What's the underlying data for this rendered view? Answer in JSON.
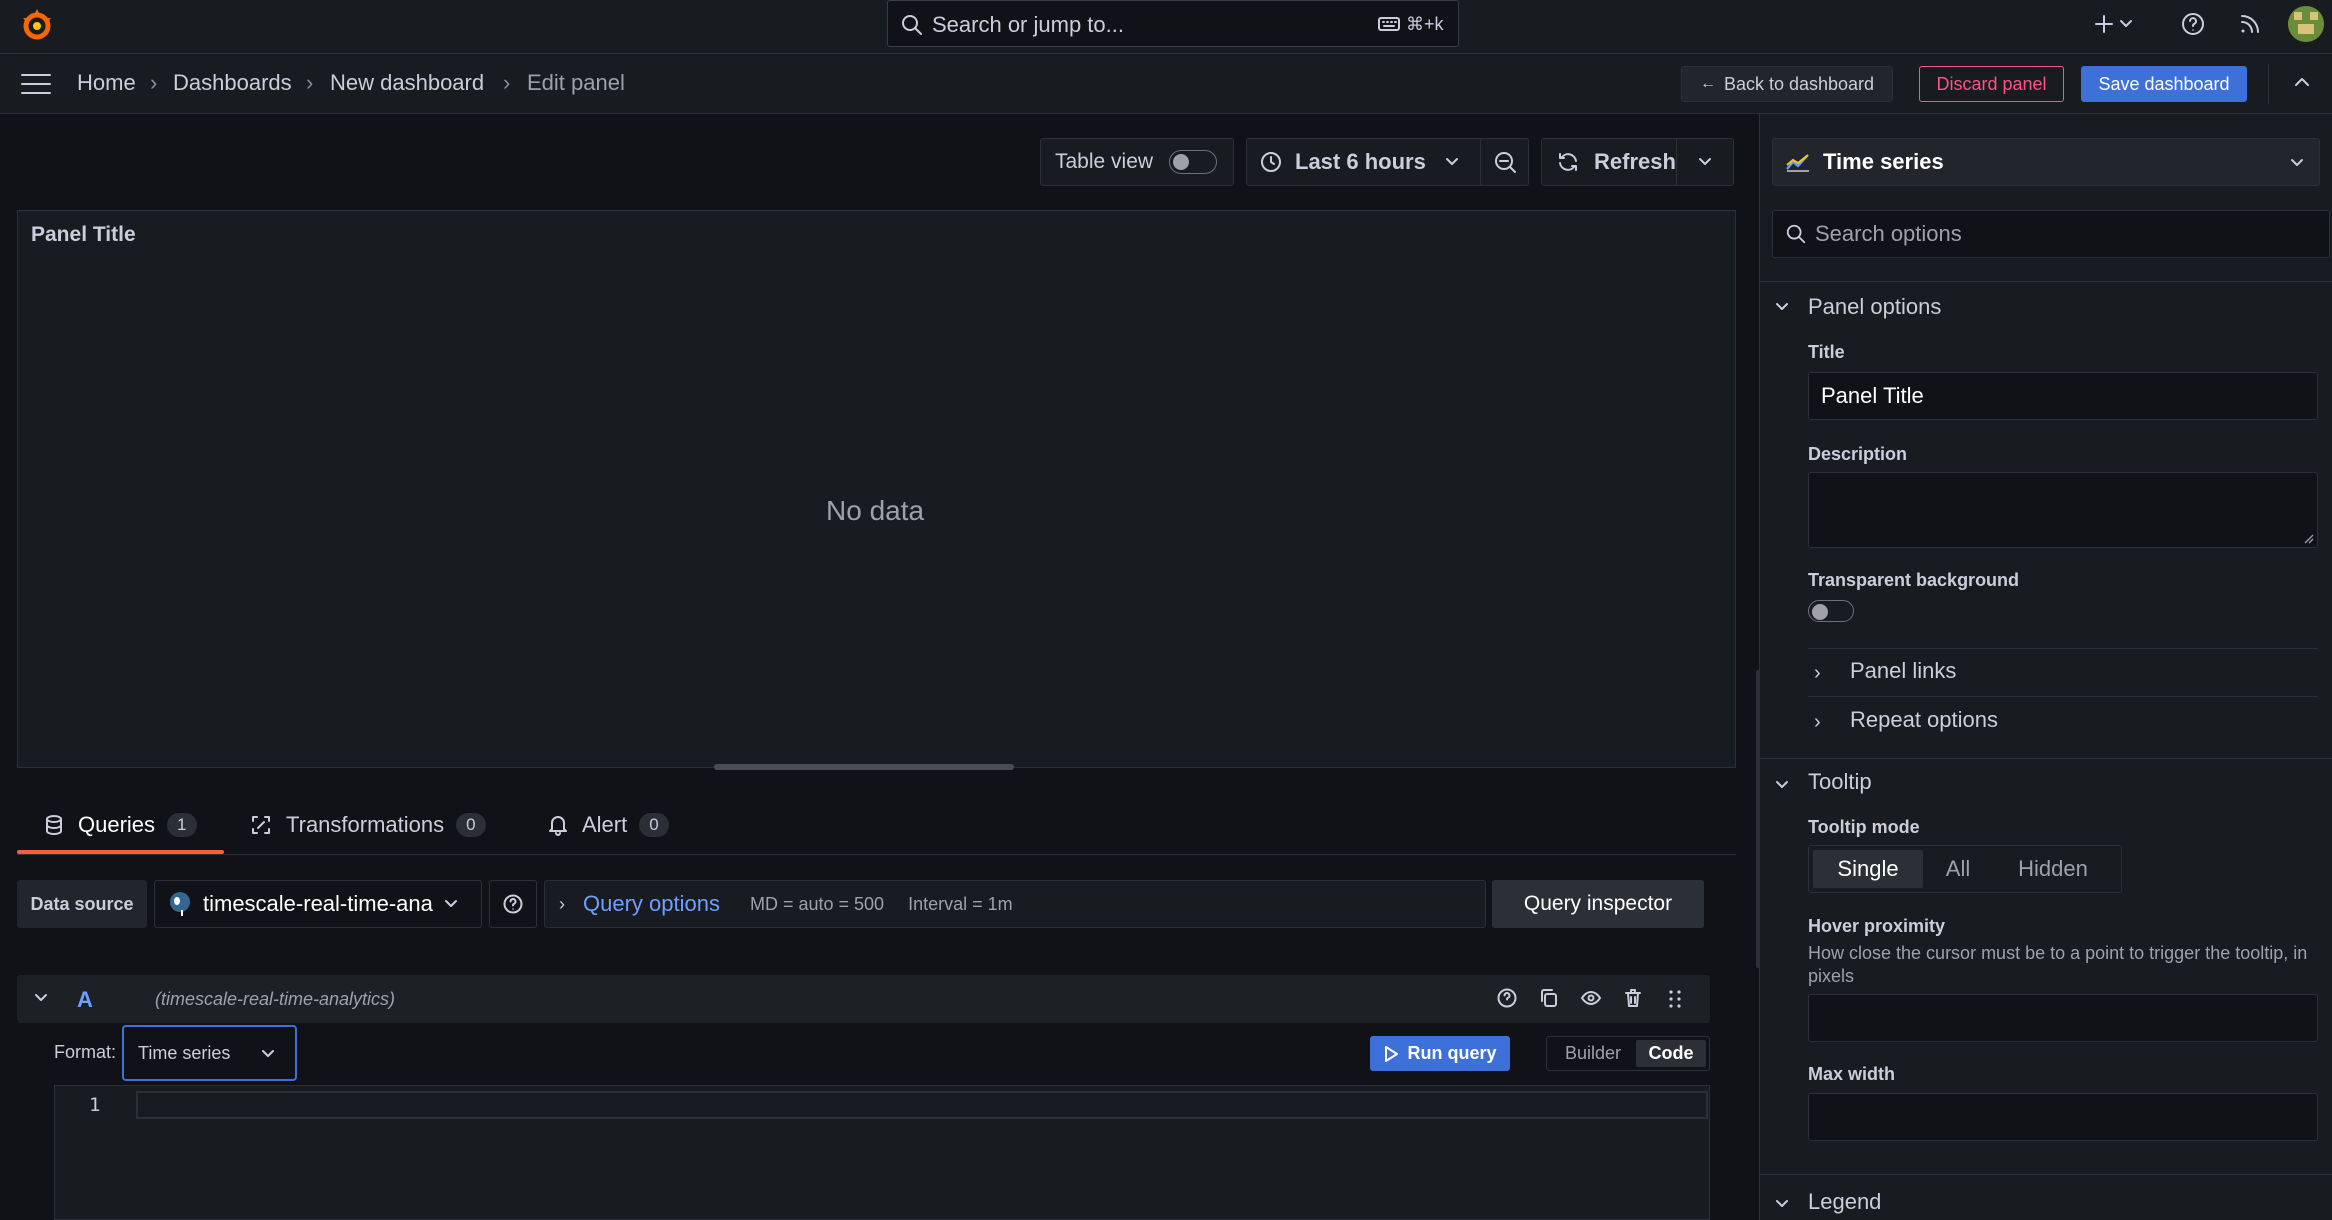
{
  "topbar": {
    "search_placeholder": "Search or jump to...",
    "search_shortcut": "⌘+k"
  },
  "breadcrumbs": [
    "Home",
    "Dashboards",
    "New dashboard",
    "Edit panel"
  ],
  "actions": {
    "back": "Back to dashboard",
    "discard": "Discard panel",
    "save": "Save dashboard"
  },
  "toolbar": {
    "table_view": "Table view",
    "time_range": "Last 6 hours",
    "refresh": "Refresh"
  },
  "panel": {
    "title": "Panel Title",
    "empty": "No data"
  },
  "tabs": [
    {
      "label": "Queries",
      "count": "1"
    },
    {
      "label": "Transformations",
      "count": "0"
    },
    {
      "label": "Alert",
      "count": "0"
    }
  ],
  "query_row": {
    "datasource_label": "Data source",
    "datasource_value": "timescale-real-time-ana",
    "query_options": "Query options",
    "md": "MD = auto = 500",
    "interval": "Interval = 1m",
    "inspector": "Query inspector"
  },
  "query": {
    "ref": "A",
    "datasource_hint": "(timescale-real-time-analytics)",
    "format_label": "Format:",
    "format_value": "Time series",
    "run": "Run query",
    "mode_builder": "Builder",
    "mode_code": "Code",
    "line_number": "1"
  },
  "options": {
    "visualization": "Time series",
    "search_placeholder": "Search options",
    "panel_options": "Panel options",
    "title_label": "Title",
    "title_value": "Panel Title",
    "description_label": "Description",
    "transparent_label": "Transparent background",
    "panel_links": "Panel links",
    "repeat_options": "Repeat options",
    "tooltip": "Tooltip",
    "tooltip_mode_label": "Tooltip mode",
    "tooltip_modes": [
      "Single",
      "All",
      "Hidden"
    ],
    "hover_label": "Hover proximity",
    "hover_desc": "How close the cursor must be to a point to trigger the tooltip, in pixels",
    "max_width_label": "Max width",
    "legend": "Legend"
  },
  "colors": {
    "accent_blue": "#3d71d9",
    "link_blue": "#6e9fff",
    "danger": "#ff5286",
    "tab_underline": "#f55f3e"
  }
}
